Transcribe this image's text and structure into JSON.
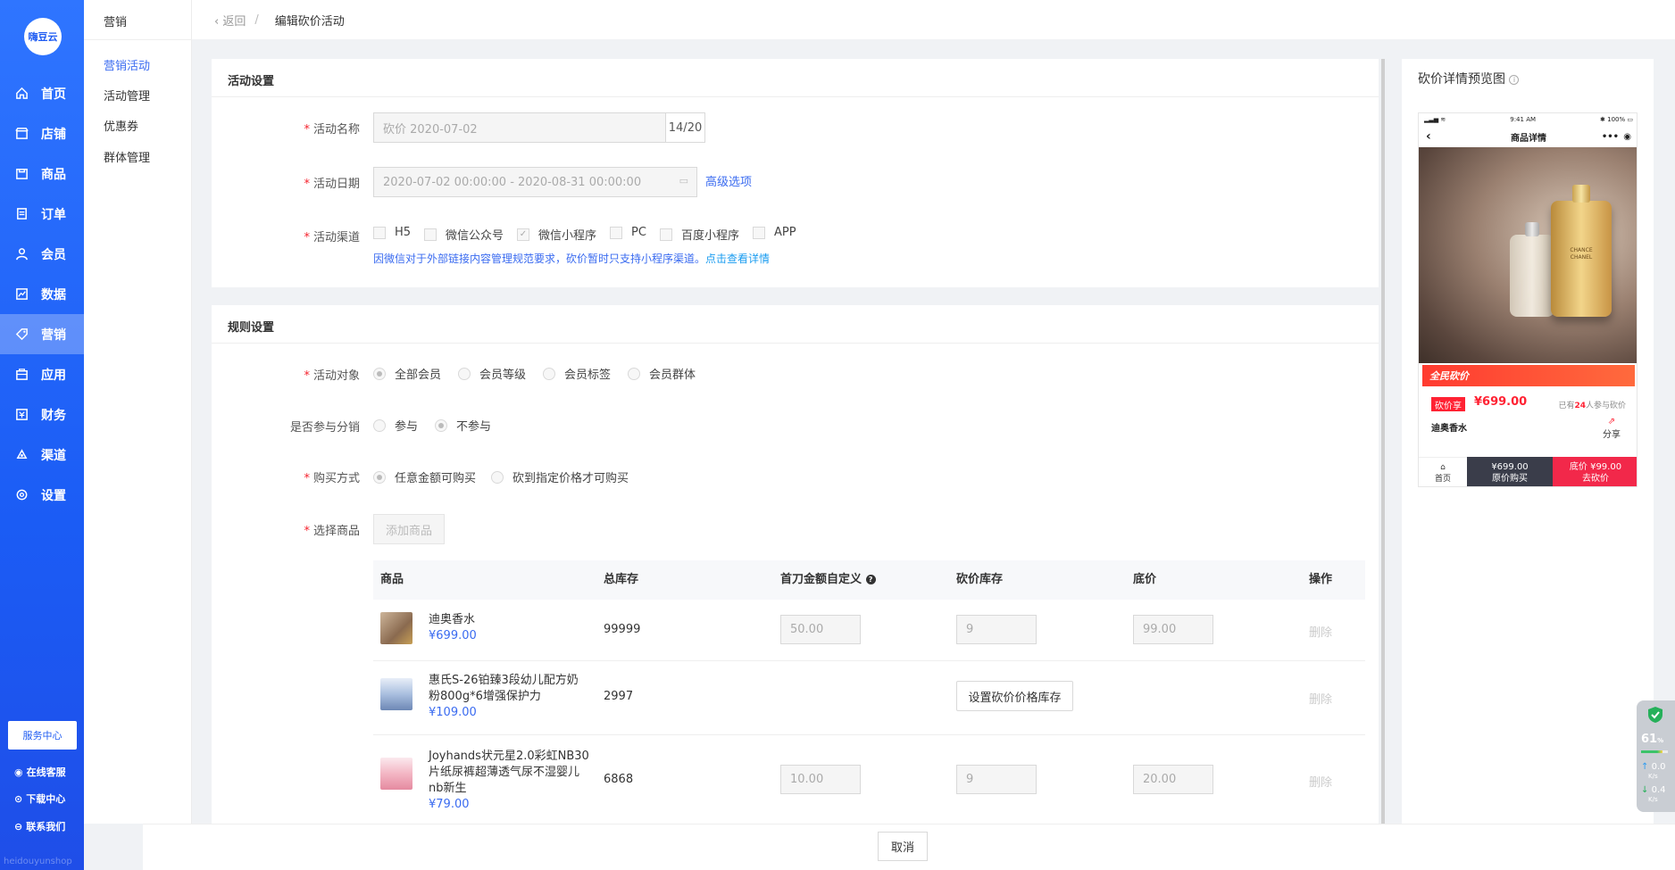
{
  "brand": {
    "logo_text": "嗨豆云"
  },
  "nav": {
    "items": [
      {
        "label": "首页",
        "icon": "home-icon"
      },
      {
        "label": "店铺",
        "icon": "store-icon"
      },
      {
        "label": "商品",
        "icon": "goods-icon"
      },
      {
        "label": "订单",
        "icon": "order-icon"
      },
      {
        "label": "会员",
        "icon": "member-icon"
      },
      {
        "label": "数据",
        "icon": "data-icon"
      },
      {
        "label": "营销",
        "icon": "tag-icon",
        "active": true
      },
      {
        "label": "应用",
        "icon": "app-icon"
      },
      {
        "label": "财务",
        "icon": "finance-icon"
      },
      {
        "label": "渠道",
        "icon": "channel-icon"
      },
      {
        "label": "设置",
        "icon": "gear-icon"
      }
    ],
    "service_center": "服务中心",
    "online_service": "在线客服",
    "download_center": "下载中心",
    "contact_us": "联系我们",
    "footer_text": "heidouyunshop"
  },
  "subnav": {
    "title": "营销",
    "items": [
      "营销活动",
      "活动管理",
      "优惠券",
      "群体管理"
    ],
    "active_index": 0
  },
  "breadcrumb": {
    "back": "返回",
    "sep": "/",
    "current": "编辑砍价活动"
  },
  "activity": {
    "section_title": "活动设置",
    "name_label": "活动名称",
    "name_value": "砍价  2020-07-02",
    "name_count": "14/20",
    "date_label": "活动日期",
    "date_value": "2020-07-02 00:00:00 - 2020-08-31 00:00:00",
    "advanced": "高级选项",
    "channel_label": "活动渠道",
    "channels": [
      "H5",
      "微信公众号",
      "微信小程序",
      "PC",
      "百度小程序",
      "APP"
    ],
    "channel_checked_index": 2,
    "notice": "因微信对于外部链接内容管理规范要求，砍价暂时只支持小程序渠道。",
    "notice_link": "点击查看详情"
  },
  "rules": {
    "section_title": "规则设置",
    "target_label": "活动对象",
    "targets": [
      "全部会员",
      "会员等级",
      "会员标签",
      "会员群体"
    ],
    "target_selected": 0,
    "dist_label": "是否参与分销",
    "dist_options": [
      "参与",
      "不参与"
    ],
    "dist_selected": 1,
    "buy_label": "购买方式",
    "buy_options": [
      "任意金额可购买",
      "砍到指定价格才可购买"
    ],
    "buy_selected": 0,
    "goods_label": "选择商品",
    "add_goods": "添加商品"
  },
  "table": {
    "headers": [
      "商品",
      "总库存",
      "首刀金额自定义",
      "砍价库存",
      "底价",
      "操作"
    ],
    "rows": [
      {
        "name": "迪奥香水",
        "price": "¥699.00",
        "stock": "99999",
        "first_cut": "50.00",
        "cut_stock": "9",
        "floor": "99.00",
        "action": "删除"
      },
      {
        "name": "惠氏S-26铂臻3段幼儿配方奶粉800g*6增强保护力",
        "price": "¥109.00",
        "stock": "2997",
        "set_button": "设置砍价价格库存",
        "action": "删除"
      },
      {
        "name": "Joyhands状元星2.0彩虹NB30片纸尿裤超薄透气尿不湿婴儿nb新生",
        "price": "¥79.00",
        "stock": "6868",
        "first_cut": "10.00",
        "cut_stock": "9",
        "floor": "20.00",
        "action": "删除"
      }
    ]
  },
  "footer": {
    "cancel": "取消"
  },
  "preview": {
    "title": "砍价详情预览图",
    "status_time": "9:41 AM",
    "status_battery": "100%",
    "header": "商品详情",
    "promo": "全民砍价",
    "tag": "砍价享",
    "price": "¥699.00",
    "joined_prefix": "已有",
    "joined_count": "24",
    "joined_suffix": "人参与砍价",
    "product_name": "迪奥香水",
    "share": "分享",
    "home": "首页",
    "orig_price": "¥699.00",
    "orig_buy": "原价购买",
    "floor_price": "底价 ¥99.00",
    "go_cut": "去砍价",
    "bottle_label": "CHANCE CHANEL"
  },
  "widget": {
    "percent": "61",
    "pct_sign": "%",
    "up": "0.0",
    "down": "0.4",
    "unit": "K/s"
  },
  "colors": {
    "accent": "#3a6bf0",
    "nav_bg": "#2f75ff",
    "danger": "#f5222d"
  }
}
